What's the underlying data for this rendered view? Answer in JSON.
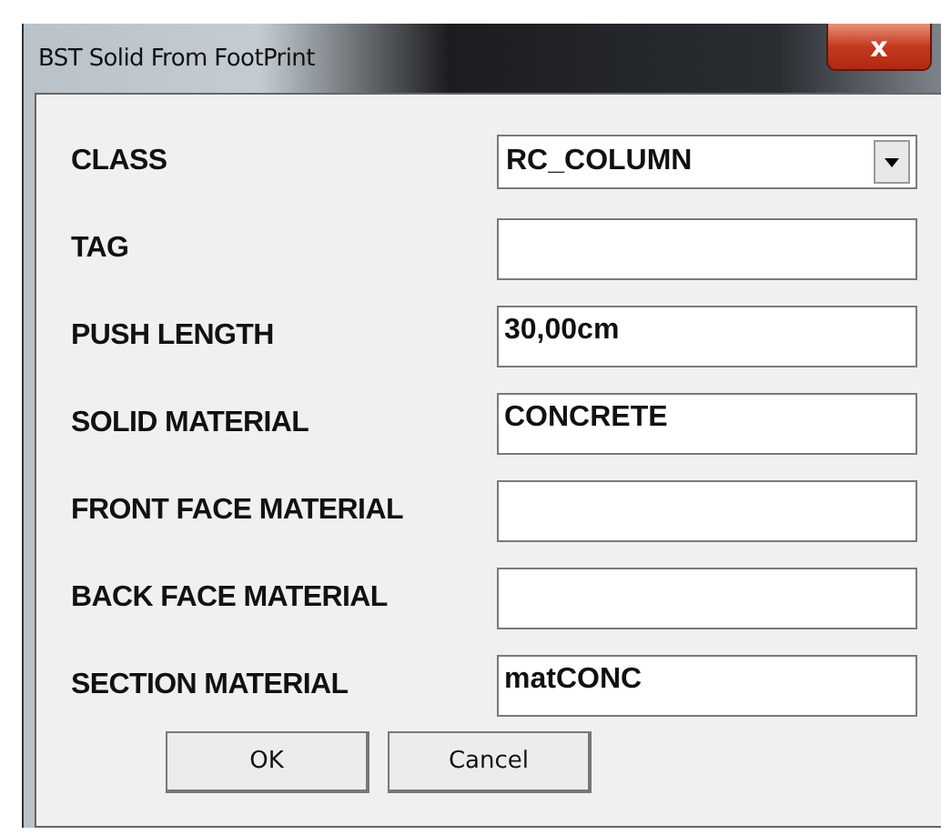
{
  "window": {
    "title": "BST Solid From FootPrint",
    "close": "x"
  },
  "fields": [
    {
      "label": "CLASS",
      "kind": "dropdown",
      "value": "RC_COLUMN"
    },
    {
      "label": "TAG",
      "kind": "text"
    },
    {
      "label": "PUSH LENGTH",
      "kind": "text",
      "value": "30,00cm"
    },
    {
      "label": "SOLID MATERIAL",
      "kind": "text",
      "value": "CONCRETE"
    },
    {
      "label": "FRONT FACE MATERIAL",
      "kind": "text"
    },
    {
      "label": "BACK FACE MATERIAL",
      "kind": "text"
    },
    {
      "label": "SECTION MATERIAL",
      "kind": "text",
      "value": "matCONC"
    }
  ],
  "buttons": [
    "OK",
    "Cancel"
  ]
}
